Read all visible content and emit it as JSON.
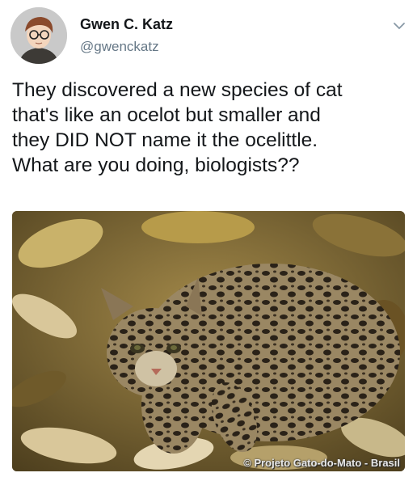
{
  "tweet": {
    "author_name": "Gwen C. Katz",
    "author_handle": "@gwenckatz",
    "text": "They discovered a new species of cat\nthat's like an ocelot but smaller and\nthey DID NOT name it the ocelittle.\nWhat are you doing, biologists??",
    "menu_icon": "chevron-down-icon",
    "avatar_icon": "avatar-illustration"
  },
  "media": {
    "photo_credit": "© Projeto Gato-do-Mato - Brasil",
    "colors": {
      "leaf_light": "#d9c79a",
      "leaf_dark": "#5a4a22",
      "cat_fur": "#9a8763",
      "cat_spot": "#2a2218"
    }
  },
  "colors": {
    "name_text": "#14171a",
    "handle_text": "#657786",
    "background": "#ffffff"
  }
}
